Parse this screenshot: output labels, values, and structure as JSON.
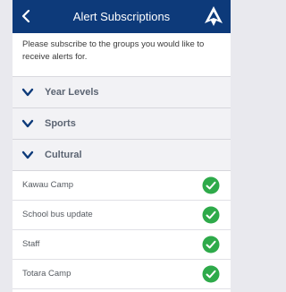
{
  "header": {
    "back_icon": "chevron-left-icon",
    "title": "Alert Subscriptions",
    "logo_icon": "school-logo-icon",
    "bg_color": "#0d3a7a"
  },
  "intro": {
    "text": "Please subscribe to the groups you would like to receive alerts for."
  },
  "groups": [
    {
      "label": "Year Levels",
      "icon": "chevron-down-icon"
    },
    {
      "label": "Sports",
      "icon": "chevron-down-icon"
    },
    {
      "label": "Cultural",
      "icon": "chevron-down-icon"
    }
  ],
  "cultural_items": [
    {
      "label": "Kawau Camp",
      "subscribed": true
    },
    {
      "label": "School bus update",
      "subscribed": true
    },
    {
      "label": "Staff",
      "subscribed": true
    },
    {
      "label": "Totara Camp",
      "subscribed": true
    }
  ],
  "colors": {
    "check_green": "#2eaa4a"
  }
}
